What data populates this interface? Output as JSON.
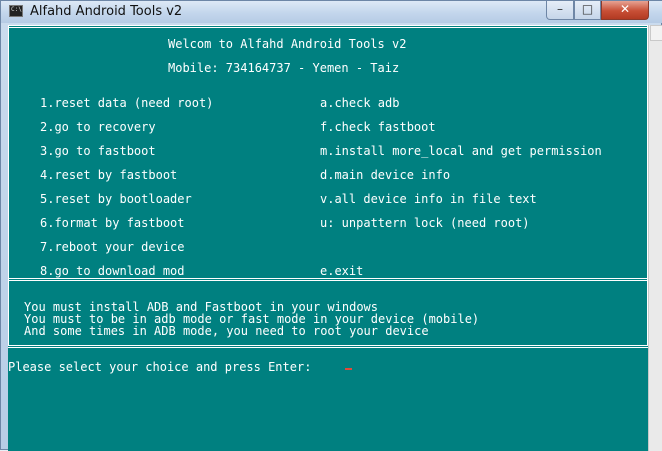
{
  "window": {
    "title": "Alfahd Android Tools v2",
    "icon": "console-app-icon",
    "controls": {
      "minimize": "–",
      "maximize": "□",
      "close": "✕"
    }
  },
  "console": {
    "background": "#008080",
    "header": {
      "line1": "Welcom to Alfahd Android Tools v2",
      "line2": "Mobile: 734164737 - Yemen - Taiz"
    },
    "menu_left": [
      "1.reset data (need root)",
      "2.go to recovery",
      "3.go to fastboot",
      "4.reset by fastboot",
      "5.reset by bootloader",
      "6.format by fastboot",
      "7.reboot your device",
      "8.go to download mod"
    ],
    "menu_right": [
      "a.check adb",
      "f.check fastboot",
      "m.install more_local and get permission",
      "d.main device info",
      "v.all device info in file text",
      "u: unpattern lock (need root)",
      "e.exit"
    ],
    "notes": [
      "You must install ADB and Fastboot in your windows",
      "You must to be in adb mode or fast mode in your device (mobile)",
      "And some times in ADB mode, you need to root your device"
    ],
    "prompt": "Please select your choice and press Enter:"
  }
}
